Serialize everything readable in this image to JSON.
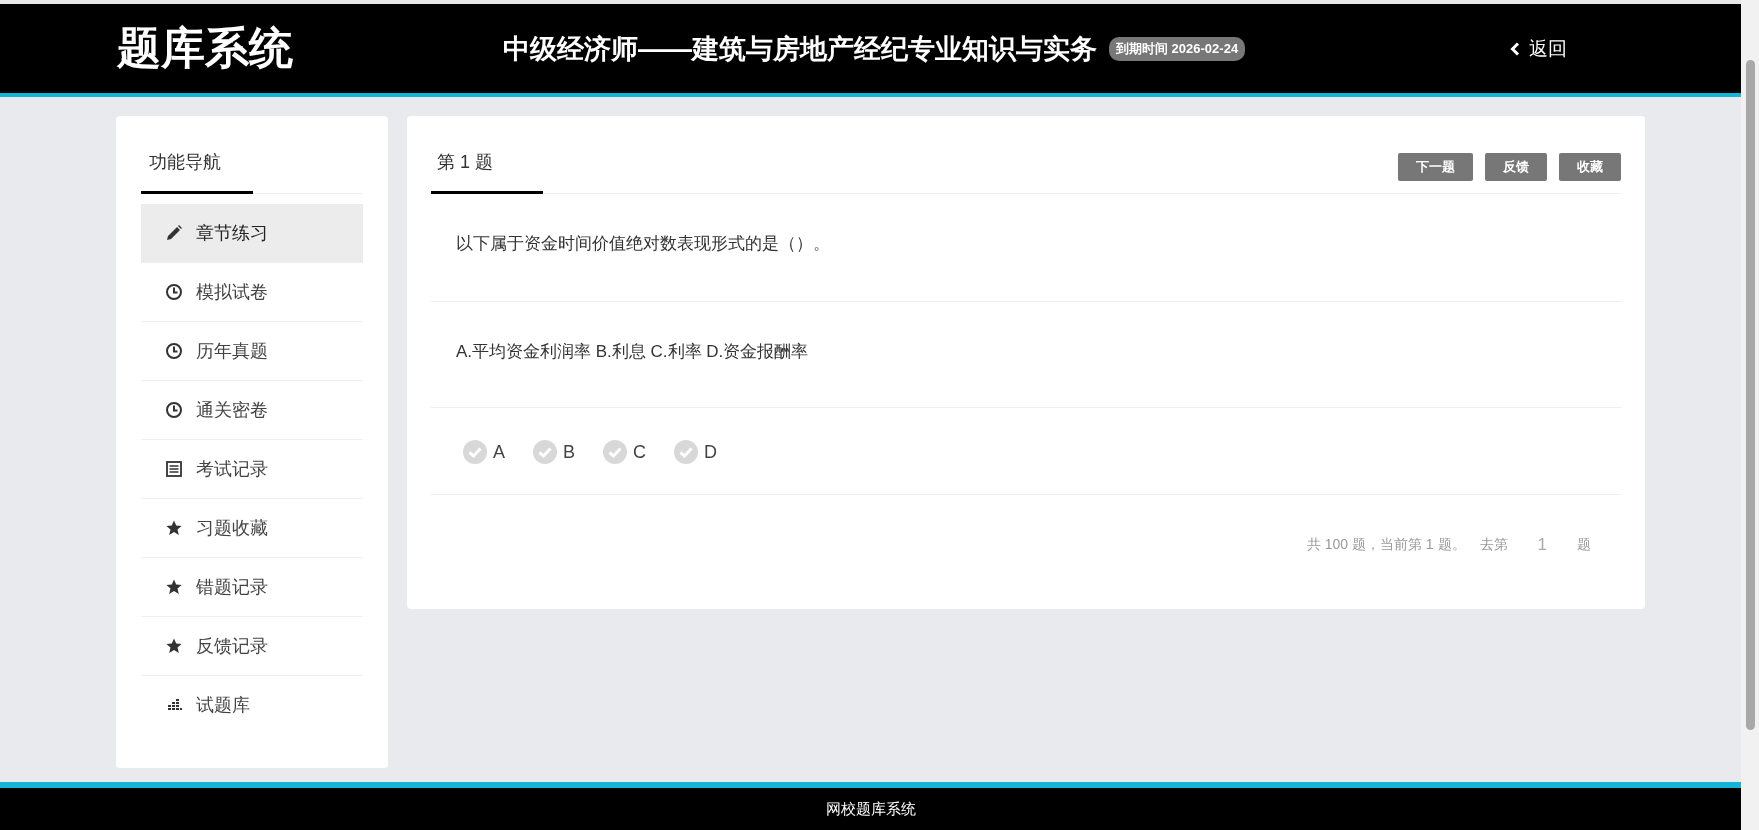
{
  "header": {
    "logo": "题库系统",
    "course_title": "中级经济师——建筑与房地产经纪专业知识与实务",
    "expiry_badge": "到期时间 2026-02-24",
    "back_link": "返回"
  },
  "sidebar": {
    "title": "功能导航",
    "items": [
      {
        "label": "章节练习",
        "kind": "pencil",
        "selected": true
      },
      {
        "label": "模拟试卷",
        "kind": "clock",
        "selected": false
      },
      {
        "label": "历年真题",
        "kind": "clock",
        "selected": false
      },
      {
        "label": "通关密卷",
        "kind": "clock",
        "selected": false
      },
      {
        "label": "考试记录",
        "kind": "list",
        "selected": false
      },
      {
        "label": "习题收藏",
        "kind": "star",
        "selected": false
      },
      {
        "label": "错题记录",
        "kind": "star",
        "selected": false
      },
      {
        "label": "反馈记录",
        "kind": "star",
        "selected": false
      },
      {
        "label": "试题库",
        "kind": "bars",
        "selected": false
      }
    ]
  },
  "question": {
    "tab": "第 1 题",
    "buttons": [
      "下一题",
      "反馈",
      "收藏"
    ],
    "stem": "以下属于资金时间价值绝对数表现形式的是（）。",
    "options_text": "A.平均资金利润率 B.利息 C.利率 D.资金报酬率",
    "choices": [
      {
        "label": "A",
        "checked": false
      },
      {
        "label": "B",
        "checked": false
      },
      {
        "label": "C",
        "checked": false
      },
      {
        "label": "D",
        "checked": false
      }
    ],
    "pager": {
      "summary": "共 100 题，当前第 1 题。",
      "goto_prefix": "去第",
      "goto_value": "1",
      "goto_suffix": "题"
    }
  },
  "footer": {
    "text": "网校题库系统"
  }
}
